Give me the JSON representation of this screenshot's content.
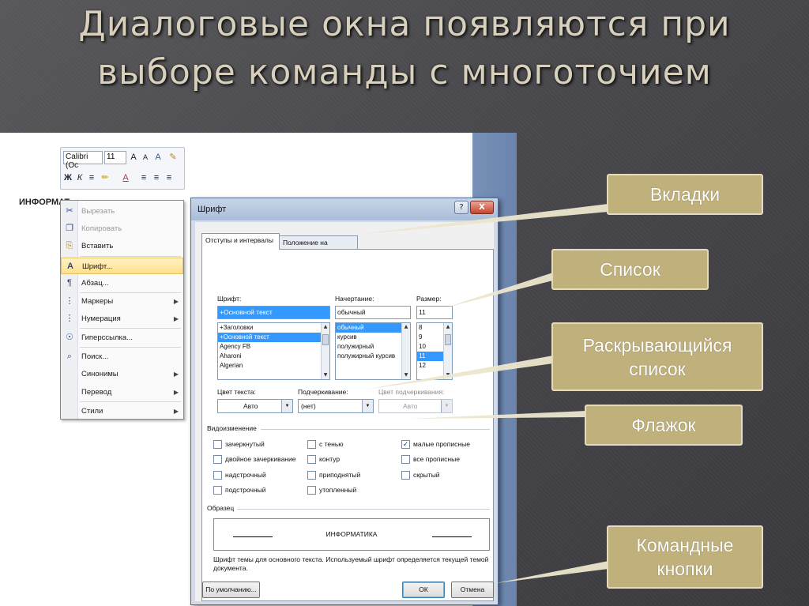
{
  "slide": {
    "title_line1": "Диалоговые окна появляются при",
    "title_line2": "выборе команды с многоточием"
  },
  "document": {
    "word": "ИНФОРМАТ"
  },
  "mini_toolbar": {
    "font": "Calibri (Ос",
    "size": "11",
    "row1_icons": [
      "A˄",
      "A˅",
      "A",
      "✎"
    ],
    "row2_icons": [
      "Ж",
      "К",
      "≡",
      "✐",
      "A",
      "≡",
      "≡",
      "≡"
    ]
  },
  "context_menu": {
    "items": [
      {
        "label": "Вырезать",
        "icon": "✂",
        "disabled": true
      },
      {
        "label": "Копировать",
        "icon": "❐",
        "disabled": true
      },
      {
        "label": "Вставить",
        "icon": "⎘",
        "disabled": false
      },
      {
        "label": "Шрифт...",
        "icon": "A",
        "selected": true
      },
      {
        "label": "Абзац...",
        "icon": "¶"
      },
      {
        "label": "Маркеры",
        "icon": "•",
        "submenu": true
      },
      {
        "label": "Нумерация",
        "icon": "1",
        "submenu": true
      },
      {
        "label": "Гиперссылка...",
        "icon": "☉"
      },
      {
        "label": "Поиск...",
        "icon": "⌕"
      },
      {
        "label": "Синонимы",
        "submenu": true
      },
      {
        "label": "Перевод",
        "submenu": true
      },
      {
        "label": "Стили",
        "submenu": true
      }
    ]
  },
  "dialog": {
    "title": "Шрифт",
    "help": "?",
    "close": "X",
    "tabs": [
      "Отступы и интервалы",
      "Положение на странице"
    ],
    "font_label": "Шрифт:",
    "font_value": "+Основной текст",
    "font_list": [
      "+Заголовки",
      "+Основной текст",
      "Agency FB",
      "Aharoni",
      "Algerian"
    ],
    "style_label": "Начертание:",
    "style_value": "обычный",
    "style_list": [
      "обычный",
      "курсив",
      "полужирный",
      "полужирный курсив"
    ],
    "size_label": "Размер:",
    "size_value": "11",
    "size_list": [
      "8",
      "9",
      "10",
      "11",
      "12"
    ],
    "color_label": "Цвет текста:",
    "color_value": "Авто",
    "underline_label": "Подчеркивание:",
    "underline_value": "(нет)",
    "underline_color_label": "Цвет подчеркивания:",
    "underline_color_value": "Авто",
    "effects_label": "Видоизменение",
    "effects": [
      {
        "label": "зачеркнутый",
        "checked": false
      },
      {
        "label": "двойное зачеркивание",
        "checked": false
      },
      {
        "label": "надстрочный",
        "checked": false
      },
      {
        "label": "подстрочный",
        "checked": false
      },
      {
        "label": "с тенью",
        "checked": false
      },
      {
        "label": "контур",
        "checked": false
      },
      {
        "label": "приподнятый",
        "checked": false
      },
      {
        "label": "утопленный",
        "checked": false
      },
      {
        "label": "малые прописные",
        "checked": true
      },
      {
        "label": "все прописные",
        "checked": false
      },
      {
        "label": "скрытый",
        "checked": false
      }
    ],
    "sample_label": "Образец",
    "sample_text": "ИНФОРМАТИКА",
    "note": "Шрифт темы для основного текста. Используемый шрифт определяется текущей темой документа.",
    "default_button": "По умолчанию...",
    "ok_button": "ОК",
    "cancel_button": "Отмена"
  },
  "callouts": {
    "tabs": "Вкладки",
    "list": "Список",
    "dropdown_line1": "Раскрывающийся",
    "dropdown_line2": "список",
    "checkbox": "Флажок",
    "buttons_line1": "Командные",
    "buttons_line2": "кнопки"
  },
  "colors": {
    "callout_bg": "#bfb07c",
    "title_text": "#d8d0bc",
    "selection": "#3399ff"
  }
}
